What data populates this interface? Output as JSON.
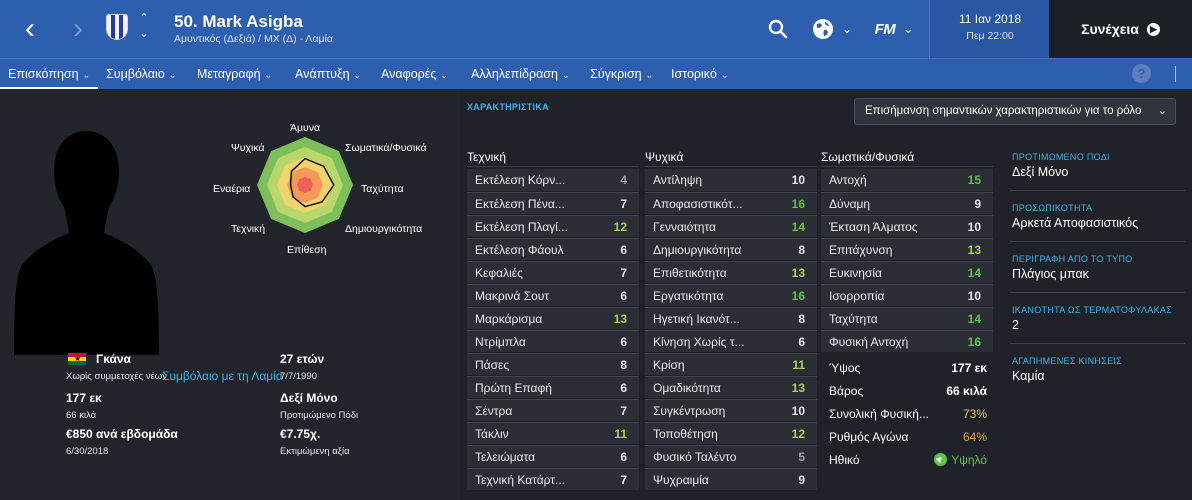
{
  "header": {
    "player_title": "50. Mark Asigba",
    "player_sub": "Αμυντικός (Δεξιά) / ΜΧ (Δ) - Λαμία",
    "date": "11 Ιαν 2018",
    "time": "Πεμ 22:00",
    "continue_label": "Συνέχεια",
    "fm_logo": "FM"
  },
  "tabs": [
    {
      "label": "Επισκόπηση",
      "active": true
    },
    {
      "label": "Συμβόλαιο"
    },
    {
      "label": "Μεταγραφή"
    },
    {
      "label": "Ανάπτυξη"
    },
    {
      "label": "Αναφορές"
    },
    {
      "label": "Αλληλεπίδραση"
    },
    {
      "label": "Σύγκριση"
    },
    {
      "label": "Ιστορικό"
    }
  ],
  "help_label": "?",
  "profile": {
    "nationality": "Γκάνα",
    "youth_caps": "Χωρίς συμμετοχές νέων",
    "age": "27 ετών",
    "dob": "7/7/1990",
    "height": "177 εκ",
    "weight": "66 κιλά",
    "foot": "Δεξί Μόνο",
    "foot_label": "Προτιμώμενο Πόδι",
    "wage": "€850 ανά εβδομάδα",
    "contract_end": "6/30/2018",
    "value": "€7.75χ.",
    "value_label": "Εκτιμώμενη αξία",
    "contract_link": "Συμβόλαιο με τη Λαμία"
  },
  "radar_labels": {
    "top": "Άμυνα",
    "top_right": "Σωματικά/Φυσικά",
    "right": "Ταχύτητα",
    "bottom_right": "Δημιουργικότητα",
    "bottom": "Επίθεση",
    "bottom_left": "Τεχνική",
    "left": "Εναέρια",
    "top_left": "Ψυχικά"
  },
  "radar_values": [
    0.55,
    0.55,
    0.6,
    0.5,
    0.45,
    0.35,
    0.3,
    0.4
  ],
  "attributes_label": "ΧΑΡΑΚΤΗΡΙΣΤΙΚΑ",
  "highlight_dropdown": "Επισήμανση σημαντικών χαρακτηριστικών για το ρόλο",
  "columns": {
    "technical": {
      "title": "Τεχνική",
      "items": [
        {
          "name": "Εκτέλεση Κόρν...",
          "value": "4"
        },
        {
          "name": "Εκτέλεση Πένα...",
          "value": "7"
        },
        {
          "name": "Εκτέλεση Πλαγί...",
          "value": "12"
        },
        {
          "name": "Εκτέλεση Φάουλ",
          "value": "6"
        },
        {
          "name": "Κεφαλιές",
          "value": "7"
        },
        {
          "name": "Μακρινά Σουτ",
          "value": "6"
        },
        {
          "name": "Μαρκάρισμα",
          "value": "13"
        },
        {
          "name": "Ντρίμπλα",
          "value": "6"
        },
        {
          "name": "Πάσες",
          "value": "8"
        },
        {
          "name": "Πρώτη Επαφή",
          "value": "6"
        },
        {
          "name": "Σέντρα",
          "value": "7"
        },
        {
          "name": "Τάκλιν",
          "value": "11"
        },
        {
          "name": "Τελειώματα",
          "value": "6"
        },
        {
          "name": "Τεχνική Κατάρτ...",
          "value": "7"
        }
      ]
    },
    "mental": {
      "title": "Ψυχικά",
      "items": [
        {
          "name": "Αντίληψη",
          "value": "10"
        },
        {
          "name": "Αποφασιστικότ...",
          "value": "16"
        },
        {
          "name": "Γενναιότητα",
          "value": "14"
        },
        {
          "name": "Δημιουργικότητα",
          "value": "8"
        },
        {
          "name": "Επιθετικότητα",
          "value": "13"
        },
        {
          "name": "Εργατικότητα",
          "value": "16"
        },
        {
          "name": "Ηγετική Ικανότ...",
          "value": "8"
        },
        {
          "name": "Κίνηση Χωρίς τ...",
          "value": "6"
        },
        {
          "name": "Κρίση",
          "value": "11"
        },
        {
          "name": "Ομαδικότητα",
          "value": "13"
        },
        {
          "name": "Συγκέντρωση",
          "value": "10"
        },
        {
          "name": "Τοποθέτηση",
          "value": "12"
        },
        {
          "name": "Φυσικό Ταλέντο",
          "value": "5"
        },
        {
          "name": "Ψυχραιμία",
          "value": "9"
        }
      ]
    },
    "physical": {
      "title": "Σωματικά/Φυσικά",
      "items": [
        {
          "name": "Αντοχή",
          "value": "15"
        },
        {
          "name": "Δύναμη",
          "value": "9"
        },
        {
          "name": "Έκταση Άλματος",
          "value": "10"
        },
        {
          "name": "Επιτάχυνση",
          "value": "13"
        },
        {
          "name": "Ευκινησία",
          "value": "14"
        },
        {
          "name": "Ισορροπία",
          "value": "10"
        },
        {
          "name": "Ταχύτητα",
          "value": "14"
        },
        {
          "name": "Φυσική Αντοχή",
          "value": "16"
        }
      ]
    }
  },
  "stats": [
    {
      "name": "Ύψος",
      "value": "177 εκ",
      "color": "#ffffff"
    },
    {
      "name": "Βάρος",
      "value": "66 κιλά",
      "color": "#ffffff"
    },
    {
      "name": "Συνολική Φυσική...",
      "value": "73%",
      "color": "#e8c44a"
    },
    {
      "name": "Ρυθμός Αγώνα",
      "value": "64%",
      "color": "#e8a23a"
    },
    {
      "name": "Ηθικό",
      "value": "Υψηλό",
      "color": "#5fc148"
    }
  ],
  "right_panel": [
    {
      "heading": "ΠΡΟΤΙΜΩΜΕΝΟ ΠΟΔΙ",
      "value": "Δεξί Μόνο"
    },
    {
      "heading": "ΠΡΟΣΩΠΙΚΟΤΗΤΑ",
      "value": "Αρκετά Αποφασιστικός"
    },
    {
      "heading": "ΠΕΡΙΓΡΑΦΗ ΑΠΟ ΤΟ ΤΥΠΟ",
      "value": "Πλάγιος μπακ"
    },
    {
      "heading": "ΙΚΑΝΟΤΗΤΑ ΩΣ ΤΕΡΜΑΤΟΦΥΛΑΚΑΣ",
      "value": "2"
    },
    {
      "heading": "ΑΓΑΠΗΜΕΝΕΣ ΚΙΝΗΣΕΙΣ",
      "value": "Καμία"
    }
  ],
  "colors": {
    "header_blue": "#2e5fae",
    "link_blue": "#3eb1e8",
    "attr_low": "#9aa0a6",
    "attr_mid": "#e6e8ea",
    "attr_good": "#a6d35b",
    "attr_high": "#5fc148"
  }
}
